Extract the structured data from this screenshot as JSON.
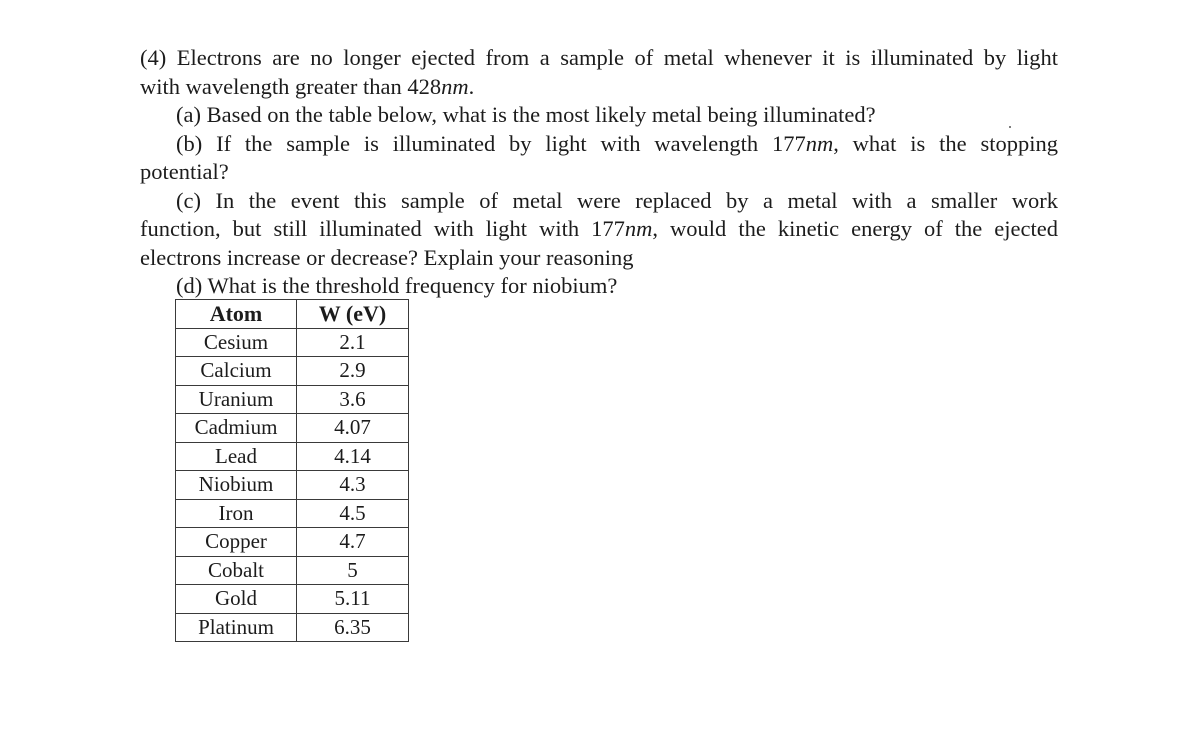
{
  "problem": {
    "number": "(4)",
    "intro_line1_pre": "Electrons are no longer ejected from a sample of metal whenever it is illuminated by light",
    "intro_line2_pre": "with wavelength greater than 428",
    "intro_line2_unit": "nm",
    "intro_line2_post": ".",
    "part_a": "(a) Based on the table below, what is the most likely metal being illuminated?",
    "part_b_line1_pre": "(b) If the sample is illuminated by light with wavelength 177",
    "part_b_line1_unit": "nm",
    "part_b_line1_post": ", what is the stopping",
    "part_b_line2": "potential?",
    "part_c_line1": "(c) In the event this sample of metal were replaced by a metal with a smaller work",
    "part_c_line2_pre": "function, but still illuminated with light with 177",
    "part_c_line2_unit": "nm",
    "part_c_line2_post": ", would the kinetic energy of the ejected",
    "part_c_line3": "electrons increase or decrease? Explain your reasoning",
    "part_d": "(d) What is the threshold frequency for niobium?"
  },
  "table": {
    "headers": [
      "Atom",
      "W (eV)"
    ],
    "rows": [
      [
        "Cesium",
        "2.1"
      ],
      [
        "Calcium",
        "2.9"
      ],
      [
        "Uranium",
        "3.6"
      ],
      [
        "Cadmium",
        "4.07"
      ],
      [
        "Lead",
        "4.14"
      ],
      [
        "Niobium",
        "4.3"
      ],
      [
        "Iron",
        "4.5"
      ],
      [
        "Copper",
        "4.7"
      ],
      [
        "Cobalt",
        "5"
      ],
      [
        "Gold",
        "5.11"
      ],
      [
        "Platinum",
        "6.35"
      ]
    ]
  }
}
